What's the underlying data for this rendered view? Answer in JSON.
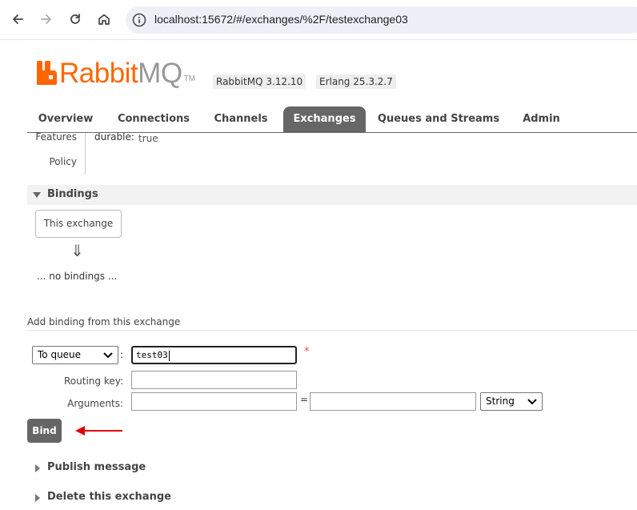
{
  "browser": {
    "url": "localhost:15672/#/exchanges/%2F/testexchange03",
    "back_icon": "arrow-left-icon",
    "forward_icon": "arrow-right-icon",
    "reload_icon": "reload-icon",
    "home_icon": "home-icon",
    "site_icon": "site-info-icon"
  },
  "header": {
    "logo_text_primary": "Rabbit",
    "logo_text_secondary": "MQ",
    "logo_tm": "TM",
    "rabbitmq_version": "RabbitMQ 3.12.10",
    "erlang_version": "Erlang 25.3.2.7",
    "brand_color": "#ff6600"
  },
  "tabs": [
    {
      "label": "Overview",
      "active": false
    },
    {
      "label": "Connections",
      "active": false
    },
    {
      "label": "Channels",
      "active": false
    },
    {
      "label": "Exchanges",
      "active": true
    },
    {
      "label": "Queues and Streams",
      "active": false
    },
    {
      "label": "Admin",
      "active": false
    }
  ],
  "features": {
    "features_label": "Features",
    "policy_label": "Policy",
    "durable_key": "durable:",
    "durable_value": "true"
  },
  "bindings": {
    "title": "Bindings",
    "this_exchange": "This exchange",
    "arrow": "⇓",
    "no_bindings": "... no bindings ..."
  },
  "add_binding": {
    "title": "Add binding from this exchange",
    "destination_type": "To queue",
    "colon": ":",
    "destination_value": "test03",
    "required_marker": "*",
    "routing_key_label": "Routing key:",
    "routing_key_value": "",
    "arguments_label": "Arguments:",
    "argument_key": "",
    "equals": "=",
    "argument_value": "",
    "argument_type": "String",
    "bind_button": "Bind",
    "annotation_arrow_color": "#e00000"
  },
  "sections": {
    "publish_message": "Publish message",
    "delete_exchange": "Delete this exchange"
  }
}
